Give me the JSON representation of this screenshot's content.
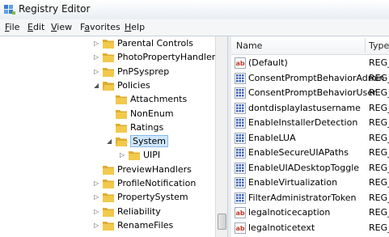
{
  "window": {
    "title": "Registry Editor"
  },
  "menubar": {
    "items": [
      {
        "accel": "F",
        "rest": "ile"
      },
      {
        "accel": "E",
        "rest": "dit"
      },
      {
        "accel": "V",
        "rest": "iew"
      },
      {
        "accel": "",
        "rest": "Favorites",
        "accel_mid": "a"
      },
      {
        "accel": "H",
        "rest": "elp"
      }
    ],
    "labels": [
      "File",
      "Edit",
      "View",
      "Favorites",
      "Help"
    ]
  },
  "tree": {
    "items": [
      {
        "label": "Parental Controls",
        "expander": "collapsed"
      },
      {
        "label": "PhotoPropertyHandler",
        "expander": "collapsed"
      },
      {
        "label": "PnPSysprep",
        "expander": "collapsed"
      },
      {
        "label": "Policies",
        "expander": "expanded"
      },
      {
        "label": "Attachments",
        "expander": "none"
      },
      {
        "label": "NonEnum",
        "expander": "none"
      },
      {
        "label": "Ratings",
        "expander": "none"
      },
      {
        "label": "System",
        "expander": "expanded",
        "selected": true
      },
      {
        "label": "UIPI",
        "expander": "collapsed"
      },
      {
        "label": "PreviewHandlers",
        "expander": "none"
      },
      {
        "label": "ProfileNotification",
        "expander": "collapsed"
      },
      {
        "label": "PropertySystem",
        "expander": "collapsed"
      },
      {
        "label": "Reliability",
        "expander": "collapsed"
      },
      {
        "label": "RenameFiles",
        "expander": "collapsed"
      }
    ]
  },
  "list": {
    "columns": {
      "name": "Name",
      "type": "Type"
    },
    "rows": [
      {
        "icon": "string-value-icon",
        "name": "(Default)",
        "type": "REG_"
      },
      {
        "icon": "dword-value-icon",
        "name": "ConsentPromptBehaviorAdmin",
        "type": "REG_"
      },
      {
        "icon": "dword-value-icon",
        "name": "ConsentPromptBehaviorUser",
        "type": "REG_"
      },
      {
        "icon": "dword-value-icon",
        "name": "dontdisplaylastusername",
        "type": "REG_"
      },
      {
        "icon": "dword-value-icon",
        "name": "EnableInstallerDetection",
        "type": "REG_"
      },
      {
        "icon": "dword-value-icon",
        "name": "EnableLUA",
        "type": "REG_"
      },
      {
        "icon": "dword-value-icon",
        "name": "EnableSecureUIAPaths",
        "type": "REG_"
      },
      {
        "icon": "dword-value-icon",
        "name": "EnableUIADesktopToggle",
        "type": "REG_"
      },
      {
        "icon": "dword-value-icon",
        "name": "EnableVirtualization",
        "type": "REG_"
      },
      {
        "icon": "dword-value-icon",
        "name": "FilterAdministratorToken",
        "type": "REG_"
      },
      {
        "icon": "string-value-icon",
        "name": "legalnoticecaption",
        "type": "REG_"
      },
      {
        "icon": "string-value-icon",
        "name": "legalnoticetext",
        "type": "REG_"
      }
    ]
  },
  "colors": {
    "selection_bg": "#cfe6fb",
    "folder": "#f2c94c",
    "dword_icon": "#3a5fb8",
    "string_icon": "#c0392b"
  }
}
